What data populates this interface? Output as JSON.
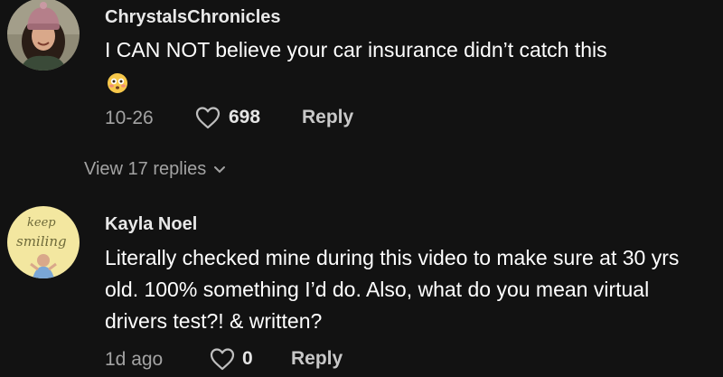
{
  "comments": [
    {
      "username": "ChrystalsChronicles",
      "text": "I CAN NOT believe your car insurance didn’t catch this",
      "emoji": "flushed-face-emoji",
      "date": "10-26",
      "likes": "698",
      "reply_label": "Reply",
      "view_replies": "View 17 replies"
    },
    {
      "username": "Kayla Noel",
      "text": "Literally checked mine during this video to make sure at 30 yrs old. 100% something I’d do. Also, what do you mean virtual drivers test?! & written?",
      "date": "1d ago",
      "likes": "0",
      "reply_label": "Reply",
      "avatar_text_line1": "keep",
      "avatar_text_line2": "smiling"
    }
  ],
  "colors": {
    "background": "#121212",
    "username": "#e8e8e8",
    "meta": "#a3a3a3",
    "avatar2_bg": "#f3e7a0"
  }
}
